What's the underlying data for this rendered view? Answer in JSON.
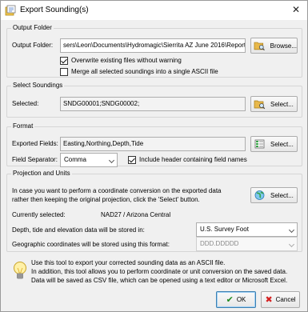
{
  "window": {
    "title": "Export Sounding(s)",
    "close_glyph": "✕"
  },
  "output_folder": {
    "group_title": "Output Folder",
    "label": "Output Folder:",
    "path": "sers\\Leon\\Documents\\Hydromagic\\Sierrita AZ June 2016\\Reports\\",
    "browse_label": "Browse...",
    "browse_icon": "folder-search-icon",
    "overwrite_label": "Overwrite existing files without warning",
    "overwrite_checked": true,
    "merge_label": "Merge all selected soundings into a single ASCII file",
    "merge_checked": false
  },
  "select_soundings": {
    "group_title": "Select Soundings",
    "label": "Selected:",
    "value": "SNDG00001;SNDG00002;",
    "select_label": "Select...",
    "select_icon": "folder-search-icon"
  },
  "format": {
    "group_title": "Format",
    "fields_label": "Exported Fields:",
    "fields_value": "Easting,Northing,Depth,Tide",
    "select_label": "Select...",
    "select_icon": "field-list-icon",
    "separator_label": "Field Separator:",
    "separator_value": "Comma",
    "header_label": "Include header containing field names",
    "header_checked": true
  },
  "projection": {
    "group_title": "Projection and Units",
    "description_line1": "In case you want to perform a coordinate conversion on the exported data",
    "description_line2": "rather then keeping the original projection, click the 'Select' button.",
    "select_label": "Select...",
    "select_icon": "globe-icon",
    "currently_label": "Currently selected:",
    "currently_value": "NAD27 / Arizona Central",
    "units_label": "Depth, tide and elevation data will be stored in:",
    "units_value": "U.S. Survey Foot",
    "geo_label": "Geographic coordinates will be stored using this format:",
    "geo_value": "DDD.DDDDD"
  },
  "info": {
    "icon": "lightbulb-icon",
    "line1": "Use this tool to export your corrected sounding data as an ASCII file.",
    "line2": "In addition, this tool allows you to perform coordinate or unit conversion on the saved data.",
    "line3": "Data will be saved as CSV file, which can be opened using a text editor or Microsoft Excel."
  },
  "footer": {
    "ok_label": "OK",
    "ok_icon": "check-icon",
    "cancel_label": "Cancel",
    "cancel_icon": "cancel-x-icon"
  },
  "colors": {
    "ok_check": "#1f8a1f",
    "cancel_x": "#d42020",
    "folder_icon": "#e8b84a",
    "globe_icon": "#3aa64a"
  }
}
